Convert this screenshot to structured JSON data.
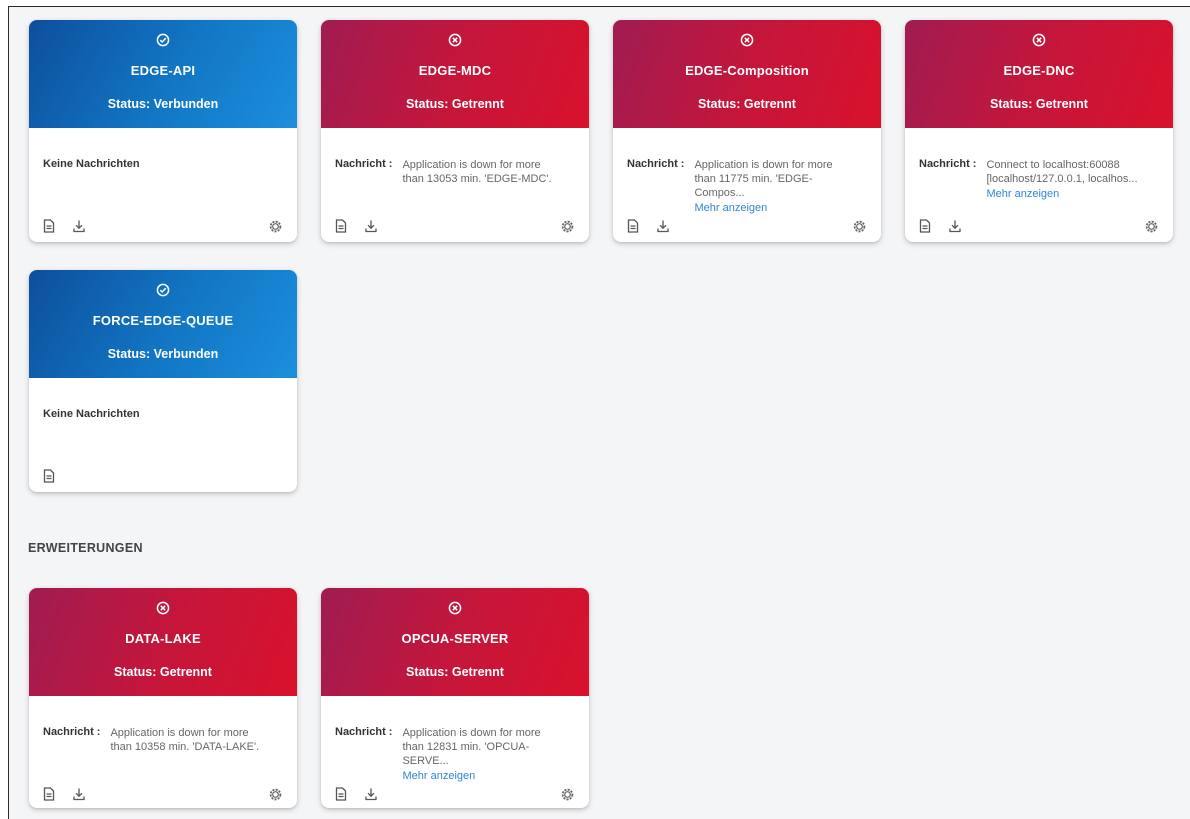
{
  "colors": {
    "connected": "#1277c5",
    "disconnected": "#c4163b",
    "link": "#2f86d6"
  },
  "icons": {
    "connected": "check-circle-icon",
    "disconnected": "x-circle-icon",
    "log": "document-icon",
    "download": "download-icon",
    "settings": "gear-icon"
  },
  "labels": {
    "message_label": "Nachricht :",
    "no_messages": "Keine Nachrichten",
    "more": "Mehr anzeigen"
  },
  "cards": [
    {
      "title": "EDGE-API",
      "status": "Status: Verbunden"
    },
    {
      "title": "EDGE-MDC",
      "status": "Status: Getrennt",
      "message": "Application is down for more than 13053 min. 'EDGE-MDC'."
    },
    {
      "title": "EDGE-Composition",
      "status": "Status: Getrennt",
      "message": "Application is down for more than 11775 min. 'EDGE-Compos..."
    },
    {
      "title": "EDGE-DNC",
      "status": "Status: Getrennt",
      "message": "Connect to localhost:60088 [localhost/127.0.0.1, localhos..."
    },
    {
      "title": "FORCE-EDGE-QUEUE",
      "status": "Status: Verbunden"
    }
  ],
  "extensions_title": "ERWEITERUNGEN",
  "extensions": [
    {
      "title": "DATA-LAKE",
      "status": "Status: Getrennt",
      "message": "Application is down for more than 10358 min. 'DATA-LAKE'."
    },
    {
      "title": "OPCUA-SERVER",
      "status": "Status: Getrennt",
      "message": "Application is down for more than 12831 min. 'OPCUA-SERVE..."
    }
  ]
}
